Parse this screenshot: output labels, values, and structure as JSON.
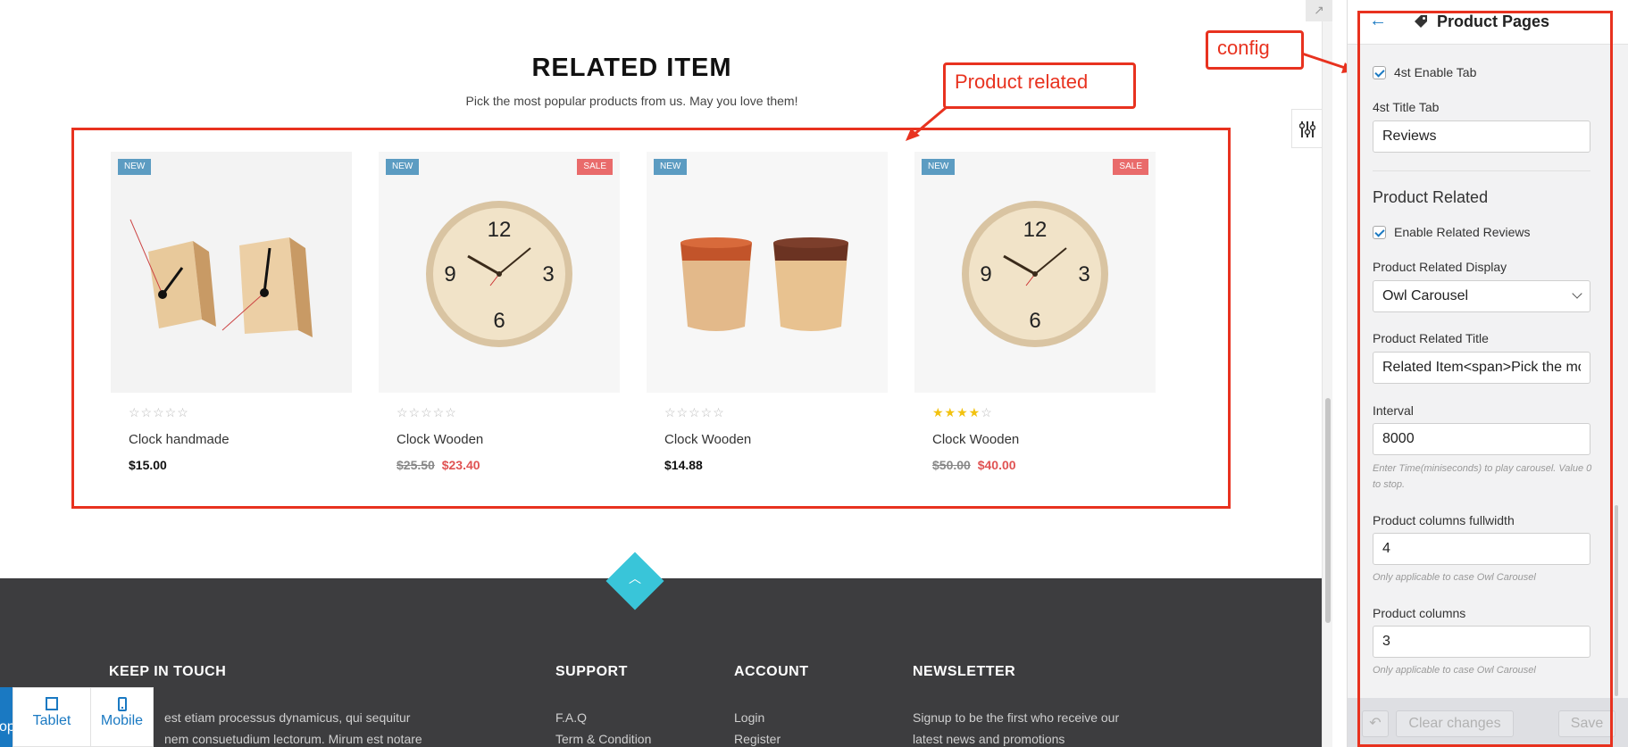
{
  "section": {
    "title": "RELATED ITEM",
    "subtitle": "Pick the most popular products from us. May you love them!"
  },
  "annotations": {
    "product_related": "Product related",
    "config": "config"
  },
  "products": [
    {
      "badge_new": "NEW",
      "badge_sale": "",
      "name": "Clock handmade",
      "price_old": "",
      "price": "$15.00",
      "rating": 0,
      "stars_max": 5
    },
    {
      "badge_new": "NEW",
      "badge_sale": "SALE",
      "name": "Clock Wooden",
      "price_old": "$25.50",
      "price": "$23.40",
      "rating": 0,
      "stars_max": 5
    },
    {
      "badge_new": "NEW",
      "badge_sale": "",
      "name": "Clock Wooden",
      "price_old": "",
      "price": "$14.88",
      "rating": 0,
      "stars_max": 5
    },
    {
      "badge_new": "NEW",
      "badge_sale": "SALE",
      "name": "Clock Wooden",
      "price_old": "$50.00",
      "price": "$40.00",
      "rating": 4,
      "stars_max": 5
    }
  ],
  "footer": {
    "keep_in_touch": {
      "title": "KEEP IN TOUCH",
      "text1": "est etiam processus dynamicus, qui sequitur",
      "text2": "nem consuetudium lectorum. Mirum est notare"
    },
    "support": {
      "title": "SUPPORT",
      "links": [
        "F.A.Q",
        "Term & Condition"
      ]
    },
    "account": {
      "title": "ACCOUNT",
      "links": [
        "Login",
        "Register"
      ]
    },
    "newsletter": {
      "title": "NEWSLETTER",
      "text1": "Signup to be the first who receive our",
      "text2": "latest news and promotions"
    }
  },
  "device_bar": {
    "partial": "op",
    "tablet": "Tablet",
    "mobile": "Mobile"
  },
  "panel": {
    "title": "Product Pages",
    "tab4_enable_label": "4st Enable Tab",
    "tab4_title_label": "4st Title Tab",
    "tab4_title_value": "Reviews",
    "group_title": "Product Related",
    "enable_related_label": "Enable Related Reviews",
    "display_label": "Product Related Display",
    "display_value": "Owl Carousel",
    "related_title_label": "Product Related Title",
    "related_title_value": "Related Item<span>Pick the most popular products from us. May you love them!</span>",
    "interval_label": "Interval",
    "interval_value": "8000",
    "interval_help": "Enter Time(miniseconds) to play carousel. Value 0 to stop.",
    "cols_full_label": "Product columns fullwidth",
    "cols_full_value": "4",
    "cols_full_help": "Only applicable to case Owl Carousel",
    "cols_label": "Product columns",
    "cols_value": "3",
    "cols_help": "Only applicable to case Owl Carousel",
    "clear_label": "Clear changes",
    "save_label": "Save"
  },
  "colors": {
    "accent": "#1a79c2",
    "annotation_red": "#e8321f",
    "sale_red": "#e05353",
    "badge_new": "#5c9cc2",
    "badge_sale": "#e96b6b",
    "footer_bg": "#3d3d3f",
    "scroll_top": "#39c5d9"
  },
  "icons": {
    "back": "arrow-left-icon",
    "tag": "tag-icon",
    "undo": "undo-icon",
    "tablet": "tablet-icon",
    "mobile": "mobile-icon",
    "tool": "sliders-icon",
    "expand": "expand-icon",
    "scroll_top": "chevron-up-icon"
  }
}
